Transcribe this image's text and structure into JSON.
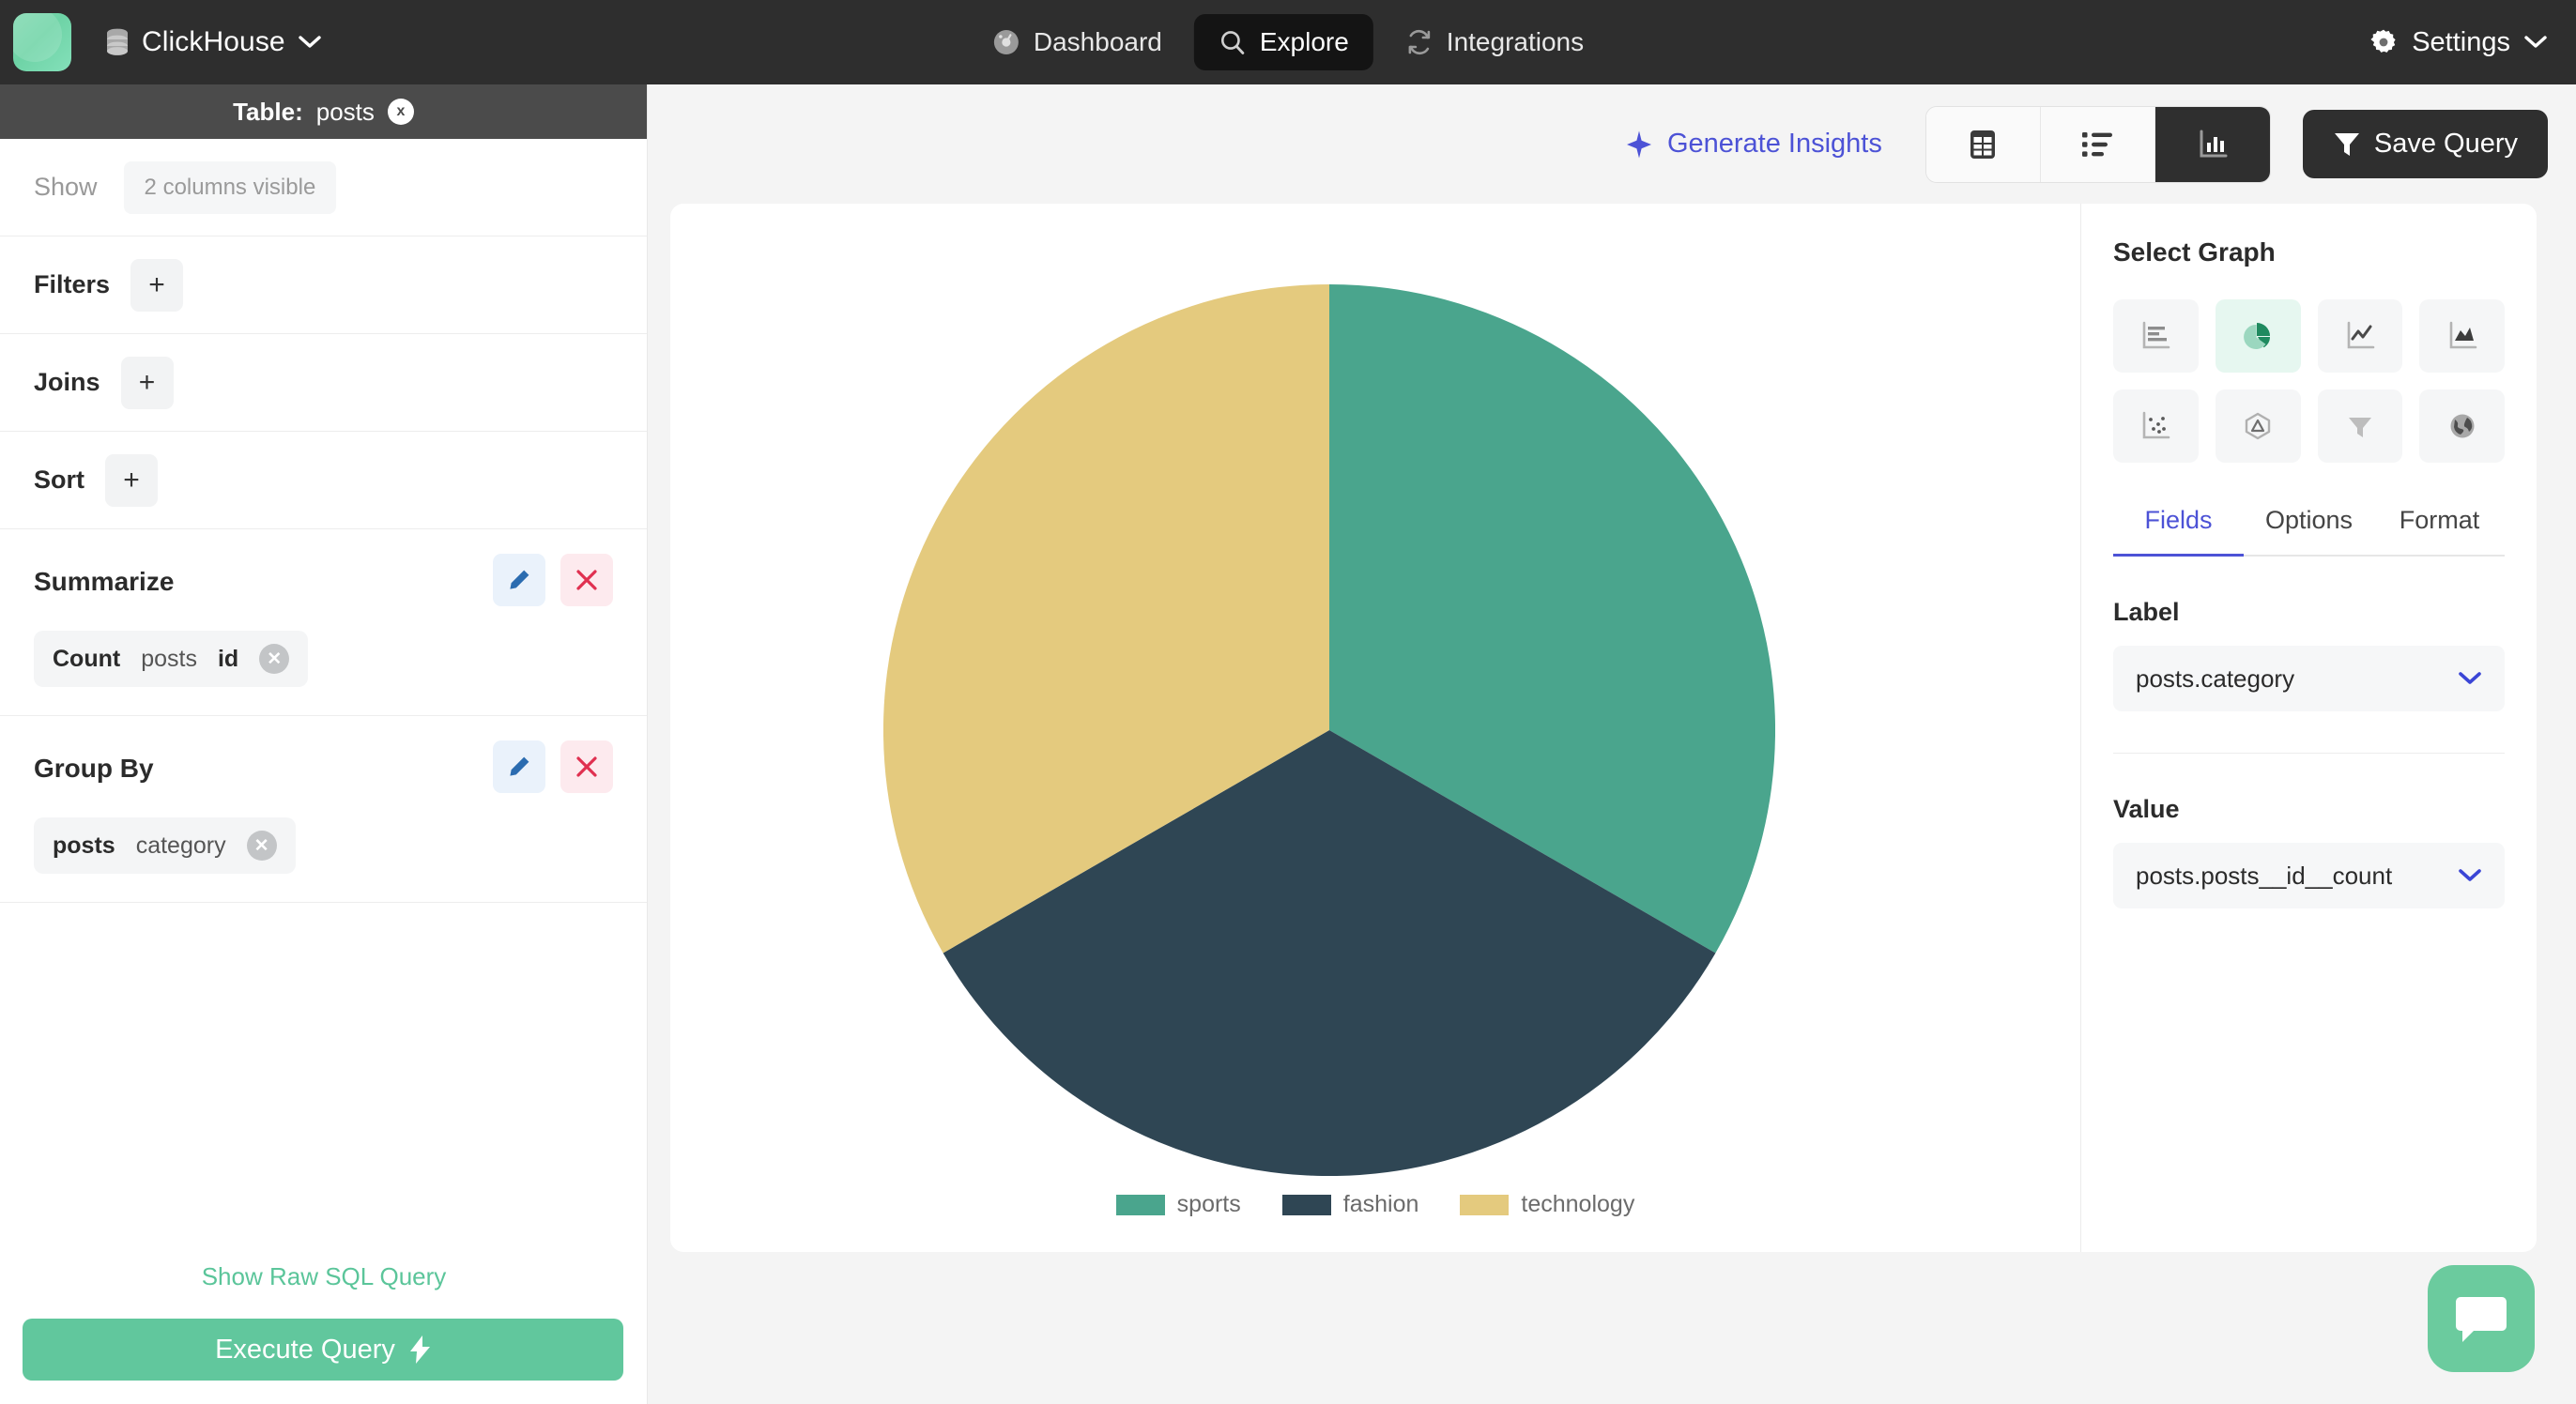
{
  "topbar": {
    "logo_name": "app-logo",
    "database": {
      "icon": "database-icon",
      "label": "ClickHouse",
      "chevron": "⌄"
    },
    "nav": [
      {
        "icon": "dashboard-icon",
        "label": "Dashboard",
        "active": false
      },
      {
        "icon": "search-icon",
        "label": "Explore",
        "active": true
      },
      {
        "icon": "refresh-icon",
        "label": "Integrations",
        "active": false
      }
    ],
    "settings": {
      "icon": "gear-icon",
      "label": "Settings"
    }
  },
  "sidebar": {
    "table_header": {
      "prefix": "Table:",
      "name": "posts",
      "close": "x"
    },
    "show": {
      "label": "Show",
      "value": "2 columns visible"
    },
    "filters": {
      "label": "Filters",
      "add": "+"
    },
    "joins": {
      "label": "Joins",
      "add": "+"
    },
    "sort": {
      "label": "Sort",
      "add": "+"
    },
    "summarize": {
      "title": "Summarize",
      "edit_icon": "pencil-icon",
      "delete_icon": "close-x-icon",
      "token": {
        "func": "Count",
        "table": "posts",
        "column": "id",
        "remove": "✕"
      }
    },
    "group_by": {
      "title": "Group By",
      "edit_icon": "pencil-icon",
      "delete_icon": "close-x-icon",
      "token": {
        "table": "posts",
        "column": "category",
        "remove": "✕"
      }
    },
    "raw_sql_link": "Show Raw SQL Query",
    "execute_button": {
      "label": "Execute Query",
      "icon": "lightning-icon"
    }
  },
  "toolbar": {
    "generate_insights": {
      "label": "Generate Insights",
      "icon": "sparkle-icon"
    },
    "view_modes": [
      {
        "name": "table-view",
        "icon": "table-icon",
        "active": false
      },
      {
        "name": "list-view",
        "icon": "list-icon",
        "active": false
      },
      {
        "name": "chart-view",
        "icon": "bar-chart-icon",
        "active": true
      }
    ],
    "save_query": {
      "label": "Save Query",
      "icon": "funnel-icon"
    }
  },
  "right_panel": {
    "select_graph_title": "Select Graph",
    "graph_types": [
      {
        "name": "horizontal-bar-chart-icon",
        "selected": false
      },
      {
        "name": "pie-chart-icon",
        "selected": true
      },
      {
        "name": "line-chart-icon",
        "selected": false
      },
      {
        "name": "area-chart-icon",
        "selected": false
      },
      {
        "name": "scatter-chart-icon",
        "selected": false
      },
      {
        "name": "radar-chart-icon",
        "selected": false
      },
      {
        "name": "funnel-chart-icon",
        "selected": false
      },
      {
        "name": "geo-map-icon",
        "selected": false
      }
    ],
    "tabs": [
      {
        "label": "Fields",
        "active": true
      },
      {
        "label": "Options",
        "active": false
      },
      {
        "label": "Format",
        "active": false
      }
    ],
    "fields": {
      "label_title": "Label",
      "label_value": "posts.category",
      "value_title": "Value",
      "value_value": "posts.posts__id__count",
      "chevron": "⌄"
    }
  },
  "chat": {
    "icon": "chat-bubble-icon"
  },
  "colors": {
    "green": "#4aa58d",
    "dark_navy": "#2f4654",
    "gold": "#e4ca7e",
    "brand_green": "#61c79d",
    "accent_blue": "#4c52d6",
    "topbar_bg": "#2e2e2e"
  },
  "chart_data": {
    "type": "pie",
    "title": "",
    "categories": [
      "sports",
      "fashion",
      "technology"
    ],
    "values": [
      33.33,
      33.33,
      33.33
    ],
    "colors": [
      "#4aa58d",
      "#2f4654",
      "#e4ca7e"
    ],
    "legend": [
      "sports",
      "fashion",
      "technology"
    ],
    "legend_position": "bottom",
    "label_field": "posts.category",
    "value_field": "posts.posts__id__count",
    "start_angle_deg": 0,
    "slice_angles_deg": [
      120,
      120,
      120
    ]
  }
}
